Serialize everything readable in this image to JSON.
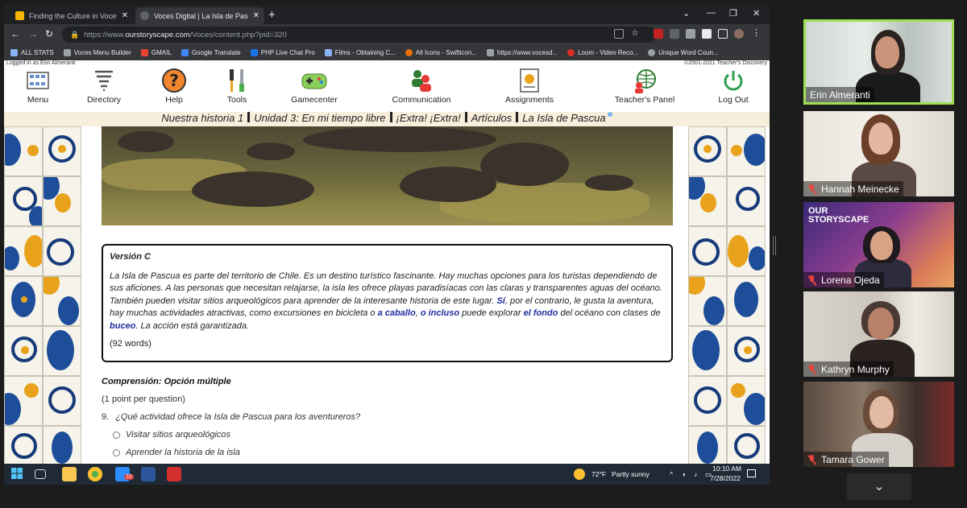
{
  "browser": {
    "tabs": [
      {
        "label": "Finding the Culture in Voces - Go",
        "close": "✕",
        "favicon_color": "#f4b400"
      },
      {
        "label": "Voces Digital | La Isla de Pascua",
        "close": "✕",
        "favicon_color": "#5f6368"
      }
    ],
    "new_tab": "+",
    "window_controls": {
      "chevron": "⌄",
      "minimize": "—",
      "restore": "❐",
      "close": "✕"
    },
    "nav": {
      "back": "←",
      "forward": "→",
      "reload": "↻"
    },
    "url_prefix": "https://www.",
    "url_domain": "ourstoryscape.com",
    "url_path": "/Voces/content.php?pid=320",
    "bookmarks": [
      {
        "label": "ALL STATS",
        "color": "#8ab4f8"
      },
      {
        "label": "Voces Menu Builder",
        "color": "#9aa0a6"
      },
      {
        "label": "GMAIL",
        "color": "#ea4335"
      },
      {
        "label": "Google Translate",
        "color": "#4285f4"
      },
      {
        "label": "PHP Live Chat Pro",
        "color": "#1a73e8"
      },
      {
        "label": "Films - Obtaining C...",
        "color": "#8ab4f8"
      },
      {
        "label": "All Icons - Swifticon...",
        "color": "#e8710a"
      },
      {
        "label": "https://www.vocesd...",
        "color": "#9aa0a6"
      },
      {
        "label": "Loom - Video Reco...",
        "color": "#d93025"
      },
      {
        "label": "Unique Word Coun...",
        "color": "#9aa0a6"
      }
    ]
  },
  "site": {
    "logged_in": "Logged in as Erin Almeranti",
    "copyright": "©2001-2021 Teacher's Discovery",
    "nav": [
      {
        "label": "Menu",
        "icon": "menu-grid-icon"
      },
      {
        "label": "Directory",
        "icon": "tornado-icon"
      },
      {
        "label": "Help",
        "icon": "help-question-icon"
      },
      {
        "label": "Tools",
        "icon": "tools-icon"
      },
      {
        "label": "Gamecenter",
        "icon": "gamepad-icon"
      },
      {
        "label": "Communication",
        "icon": "people-icon"
      },
      {
        "label": "Assignments",
        "icon": "certificate-icon"
      },
      {
        "label": "Teacher's Panel",
        "icon": "globe-person-icon"
      },
      {
        "label": "Log Out",
        "icon": "power-icon"
      }
    ],
    "breadcrumb": [
      "Nuestra historia 1",
      "Unidad 3: En mi tiempo libre",
      "¡Extra! ¡Extra!",
      "Artículos",
      "La Isla de Pascua"
    ],
    "reading": {
      "version": "Versión C",
      "p1": "La Isla de Pascua es parte del territorio de Chile. Es un destino turístico fascinante. Hay muchas opciones para los turistas dependiendo de sus aficiones. A las personas que necesitan relajarse, la isla les ofrece playas paradisíacas con las claras y transparentes aguas del océano. También pueden visitar sitios arqueológicos para aprender de la interesante historia de este lugar. ",
      "kw1": "Sí",
      "p2": ", por el contrario, le gusta la aventura, hay muchas actividades atractivas, como excursiones en bicicleta o ",
      "kw2": "a caballo",
      "p3": ", ",
      "kw3": "o incluso",
      "p4": " puede explorar ",
      "kw4": "el fondo",
      "p5": " del océano con clases de ",
      "kw5": "buceo",
      "p6": ". La acción está garantizada.",
      "word_count": "(92 words)"
    },
    "comprehension_title": "Comprensión: Opción múltiple",
    "points": "(1 point per question)",
    "question_number": "9.",
    "question_text": "¿Qué actividad ofrece la Isla de Pascua para los aventureros?",
    "options": [
      "Visitar sitios arqueológicos",
      "Aprender la historia de la isla"
    ]
  },
  "taskbar": {
    "weather_temp": "72°F",
    "weather_text": "Partly sunny",
    "time": "10:10 AM",
    "date": "7/28/2022",
    "badge": "10"
  },
  "participants": [
    {
      "name": "Erin Almeranti",
      "muted": false,
      "active": true
    },
    {
      "name": "Hannah Meinecke",
      "muted": true,
      "active": false
    },
    {
      "name": "Lorena Ojeda",
      "muted": true,
      "active": false
    },
    {
      "name": "Kathryn Murphy",
      "muted": true,
      "active": false
    },
    {
      "name": "Tamara Gower",
      "muted": true,
      "active": false
    }
  ],
  "brand_logo": {
    "line1": "OUR",
    "line2": "STORYSCAPE"
  },
  "panel_toggle": "⌄"
}
